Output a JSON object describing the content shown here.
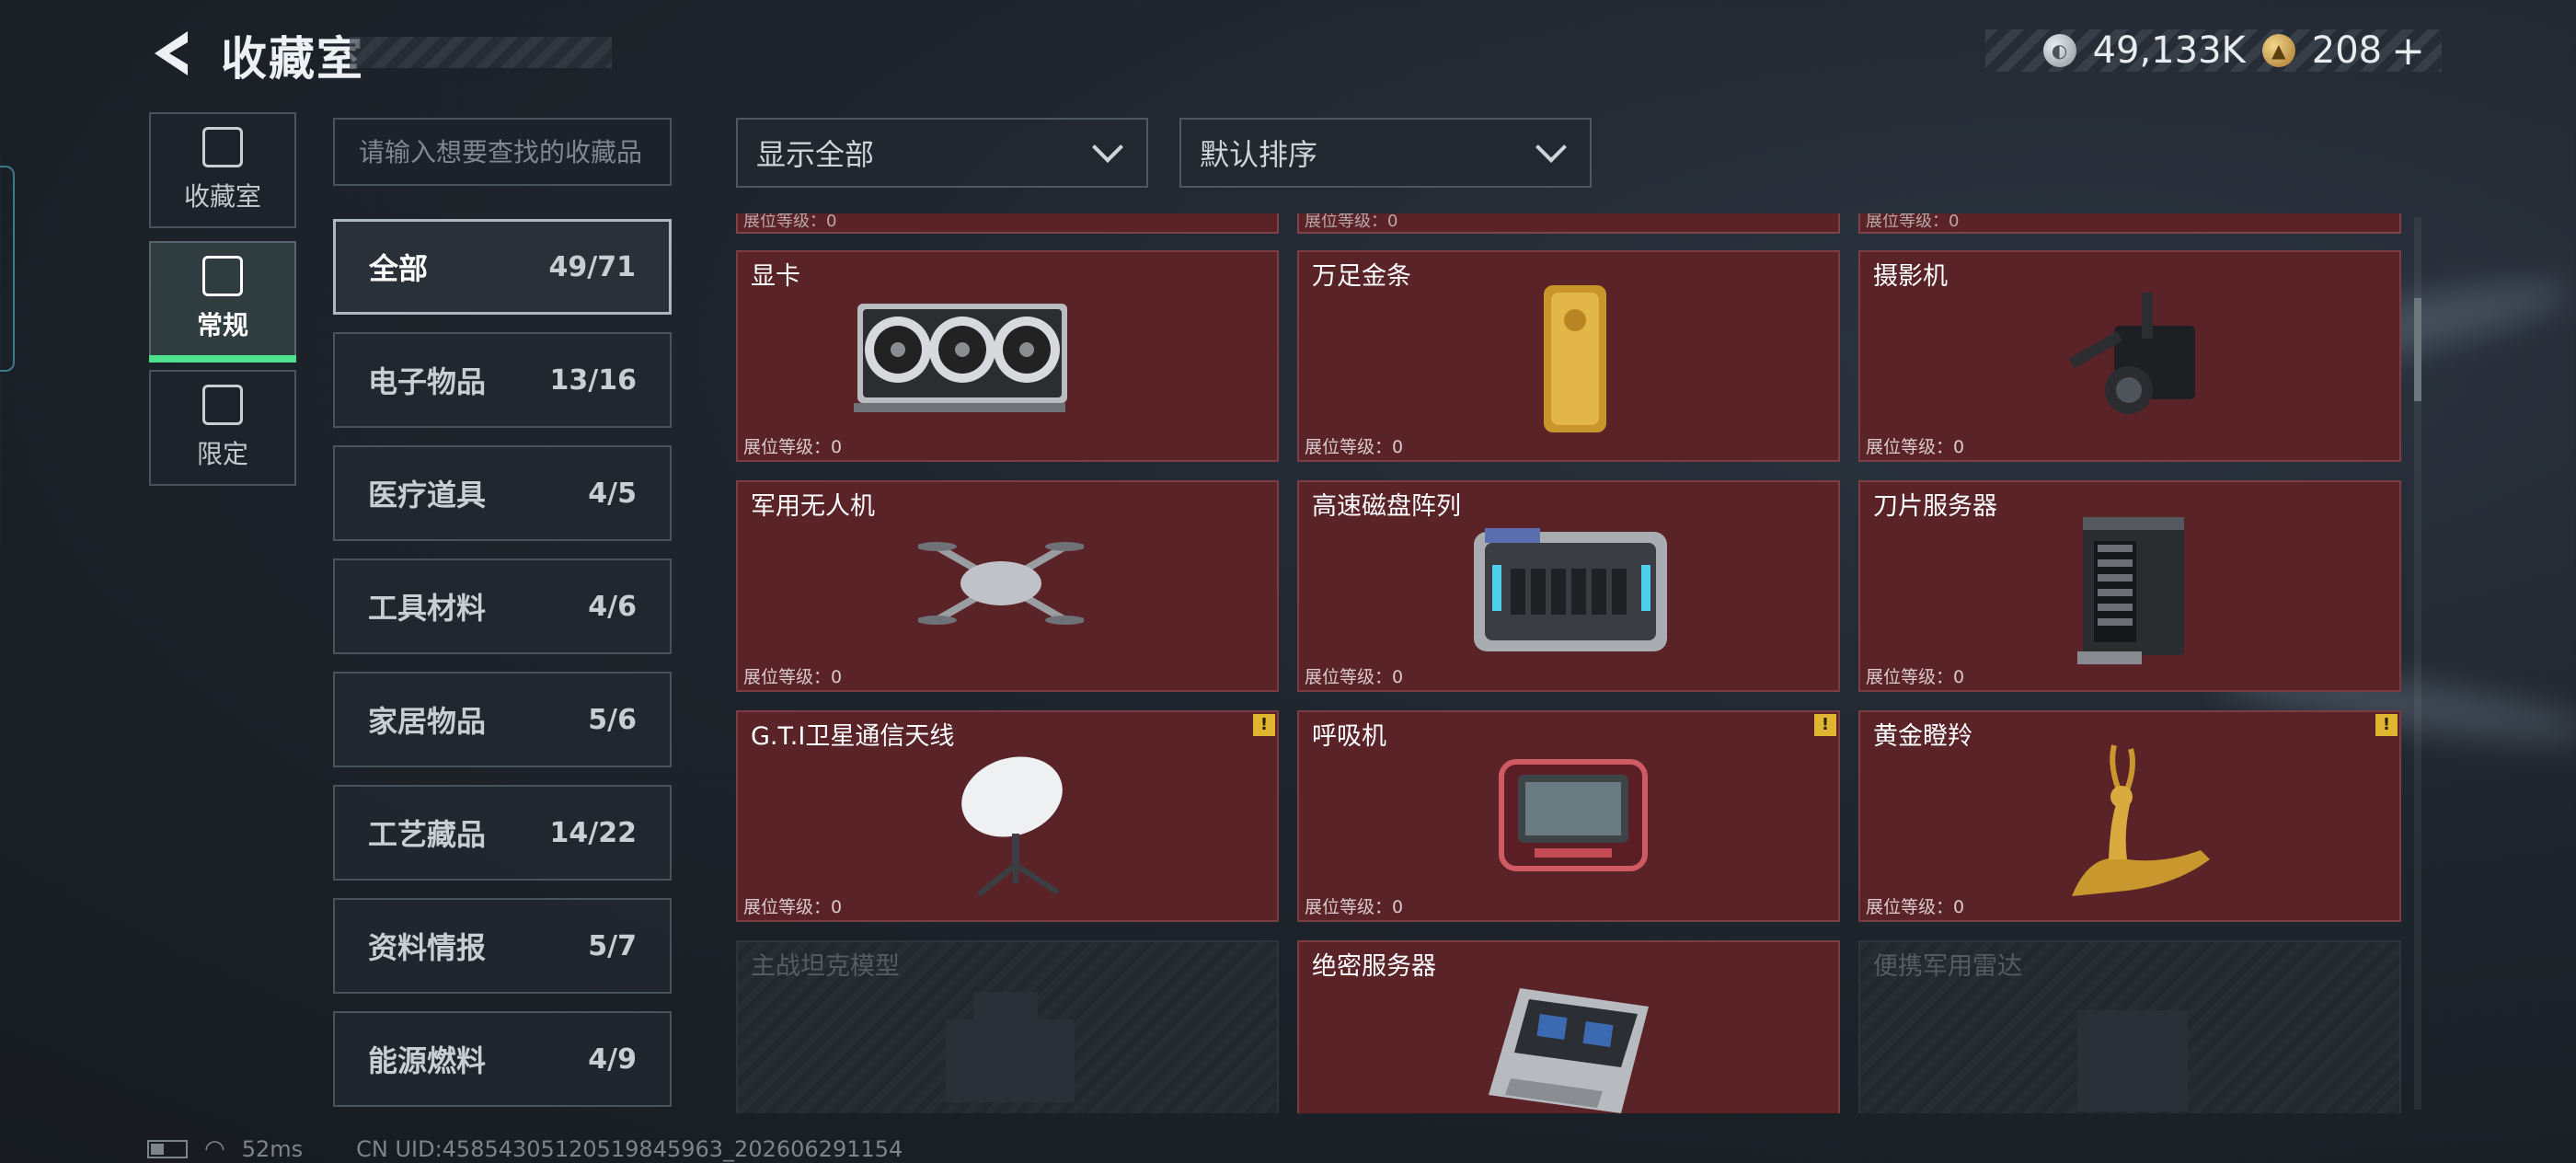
{
  "header": {
    "title": "收藏室"
  },
  "currency": {
    "silver": "49,133K",
    "gold": "208",
    "add_label": "+"
  },
  "side_nav": [
    {
      "label": "收藏室",
      "icon": "vault-icon",
      "active": false
    },
    {
      "label": "常规",
      "icon": "gallery-icon",
      "active": true
    },
    {
      "label": "限定",
      "icon": "limited-icon",
      "active": false
    }
  ],
  "search": {
    "placeholder": "请输入想要查找的收藏品"
  },
  "categories": [
    {
      "name": "全部",
      "count": "49/71",
      "active": true
    },
    {
      "name": "电子物品",
      "count": "13/16"
    },
    {
      "name": "医疗道具",
      "count": "4/5"
    },
    {
      "name": "工具材料",
      "count": "4/6"
    },
    {
      "name": "家居物品",
      "count": "5/6"
    },
    {
      "name": "工艺藏品",
      "count": "14/22"
    },
    {
      "name": "资料情报",
      "count": "5/7"
    },
    {
      "name": "能源燃料",
      "count": "4/9"
    }
  ],
  "filters": {
    "show": "显示全部",
    "sort": "默认排序"
  },
  "level_label": "展位等级：0",
  "items": [
    {
      "name": "显卡",
      "icon": "graphics-card-icon",
      "level": "展位等级：0",
      "alert": false,
      "locked": false
    },
    {
      "name": "万足金条",
      "icon": "gold-bar-icon",
      "level": "展位等级：0",
      "alert": false,
      "locked": false
    },
    {
      "name": "摄影机",
      "icon": "camera-icon",
      "level": "展位等级：0",
      "alert": false,
      "locked": false
    },
    {
      "name": "军用无人机",
      "icon": "drone-icon",
      "level": "展位等级：0",
      "alert": false,
      "locked": false
    },
    {
      "name": "高速磁盘阵列",
      "icon": "disk-array-icon",
      "level": "展位等级：0",
      "alert": false,
      "locked": false
    },
    {
      "name": "刀片服务器",
      "icon": "blade-server-icon",
      "level": "展位等级：0",
      "alert": false,
      "locked": false
    },
    {
      "name": "G.T.I卫星通信天线",
      "icon": "satellite-dish-icon",
      "level": "展位等级：0",
      "alert": true,
      "locked": false
    },
    {
      "name": "呼吸机",
      "icon": "ventilator-icon",
      "level": "展位等级：0",
      "alert": true,
      "locked": false
    },
    {
      "name": "黄金瞪羚",
      "icon": "golden-gazelle-icon",
      "level": "展位等级：0",
      "alert": true,
      "locked": false
    },
    {
      "name": "主战坦克模型",
      "icon": "tank-model-icon",
      "level": "",
      "alert": false,
      "locked": true
    },
    {
      "name": "绝密服务器",
      "icon": "secret-server-icon",
      "level": "",
      "alert": false,
      "locked": false
    },
    {
      "name": "便携军用雷达",
      "icon": "radar-icon",
      "level": "",
      "alert": false,
      "locked": true
    }
  ],
  "alert_mark": "!",
  "footer": {
    "ping": "52ms",
    "uid": "CN UID:4585430512051984596​3_202606291154"
  }
}
